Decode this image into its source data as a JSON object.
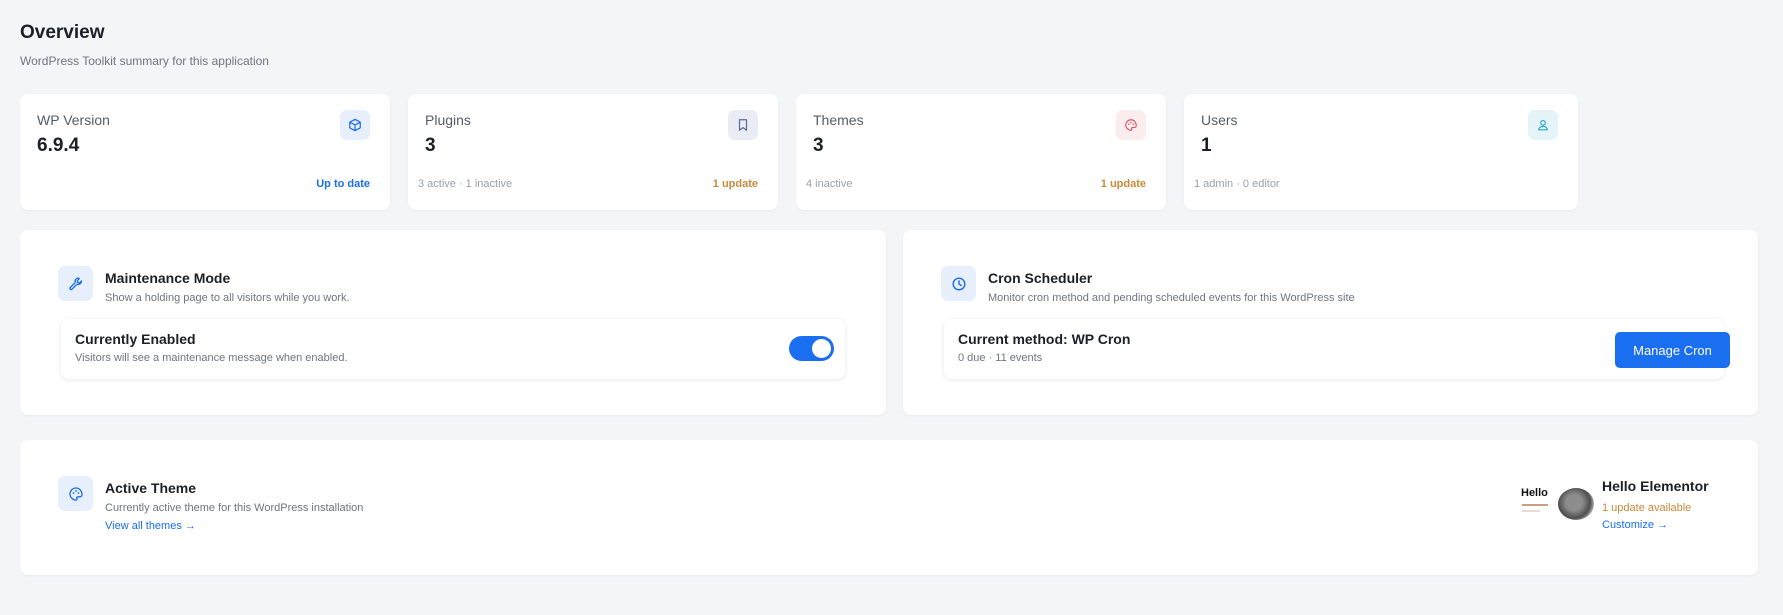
{
  "header": {
    "title": "Overview",
    "subtitle": "WordPress Toolkit summary for this application"
  },
  "stats": [
    {
      "label": "WP Version",
      "value": "6.9.4",
      "foot_left": "",
      "foot_right": "Up to date",
      "icon": "cube-icon",
      "accent": "#1a6ef0",
      "foot_color": "#1a6ef0"
    },
    {
      "label": "Plugins",
      "value": "3",
      "foot_left": "3 active · 1 inactive",
      "foot_right": "1 update",
      "icon": "bookmark-icon",
      "accent": "#5b6b9a",
      "foot_color": "#c98a3a"
    },
    {
      "label": "Themes",
      "value": "3",
      "foot_left": "4 inactive",
      "foot_right": "1 update",
      "icon": "palette-icon",
      "accent": "#d45b6b",
      "foot_color": "#c98a3a"
    },
    {
      "label": "Users",
      "value": "1",
      "foot_left": "1 admin · 0 editor",
      "foot_right": "",
      "icon": "user-icon",
      "accent": "#2aa6c7",
      "foot_color": "#1a6ef0"
    }
  ],
  "maintenance": {
    "title": "Maintenance Mode",
    "description": "Show a holding page to all visitors while you work.",
    "status_title": "Currently Enabled",
    "status_sub": "Visitors will see a maintenance message when enabled.",
    "enabled": true
  },
  "cron": {
    "title": "Cron Scheduler",
    "description": "Monitor cron method and pending scheduled events for this WordPress site",
    "method_label": "Current method:",
    "method_value": "WP Cron",
    "stats": "0 due · 11 events",
    "button_label": "Manage Cron"
  },
  "active_theme": {
    "title": "Active Theme",
    "description": "Currently active theme for this WordPress installation",
    "link_label": "View all themes →",
    "theme_name": "Hello Elementor",
    "update_text": "1 update available",
    "customize_label": "Customize →",
    "thumb_text": "Hello"
  },
  "colors": {
    "accent": "#1a6ef0",
    "warning": "#c98a3a"
  }
}
